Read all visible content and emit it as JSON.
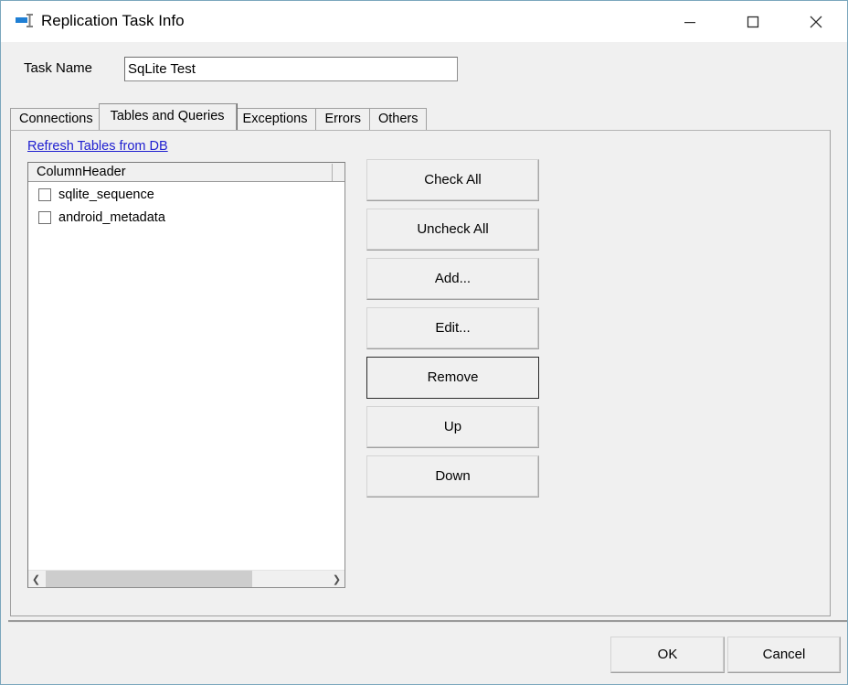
{
  "window": {
    "title": "Replication Task Info",
    "icon": "replication-task-icon",
    "border_color": "#7ba7bd",
    "controls": {
      "minimize": "—",
      "maximize": "☐",
      "close": "×"
    }
  },
  "task": {
    "label": "Task Name",
    "value": "SqLite Test",
    "placeholder": ""
  },
  "tabs": [
    {
      "label": "Connections",
      "selected": false
    },
    {
      "label": "Tables and Queries",
      "selected": true
    },
    {
      "label": "Exceptions",
      "selected": false
    },
    {
      "label": "Errors",
      "selected": false
    },
    {
      "label": "Others",
      "selected": false
    }
  ],
  "panel": {
    "refresh_link": "Refresh Tables from DB",
    "link_color": "#2020d0",
    "list": {
      "column_header": "ColumnHeader",
      "rows": [
        {
          "label": "sqlite_sequence",
          "checked": false
        },
        {
          "label": "android_metadata",
          "checked": false
        }
      ],
      "scrollbar": {
        "left_arrow": "❮",
        "right_arrow": "❯"
      }
    },
    "buttons": [
      {
        "label": "Check All",
        "default": false
      },
      {
        "label": "Uncheck All",
        "default": false
      },
      {
        "label": "Add...",
        "default": false
      },
      {
        "label": "Edit...",
        "default": false
      },
      {
        "label": "Remove",
        "default": true
      },
      {
        "label": "Up",
        "default": false
      },
      {
        "label": "Down",
        "default": false
      }
    ]
  },
  "footer": {
    "ok": "OK",
    "cancel": "Cancel"
  }
}
